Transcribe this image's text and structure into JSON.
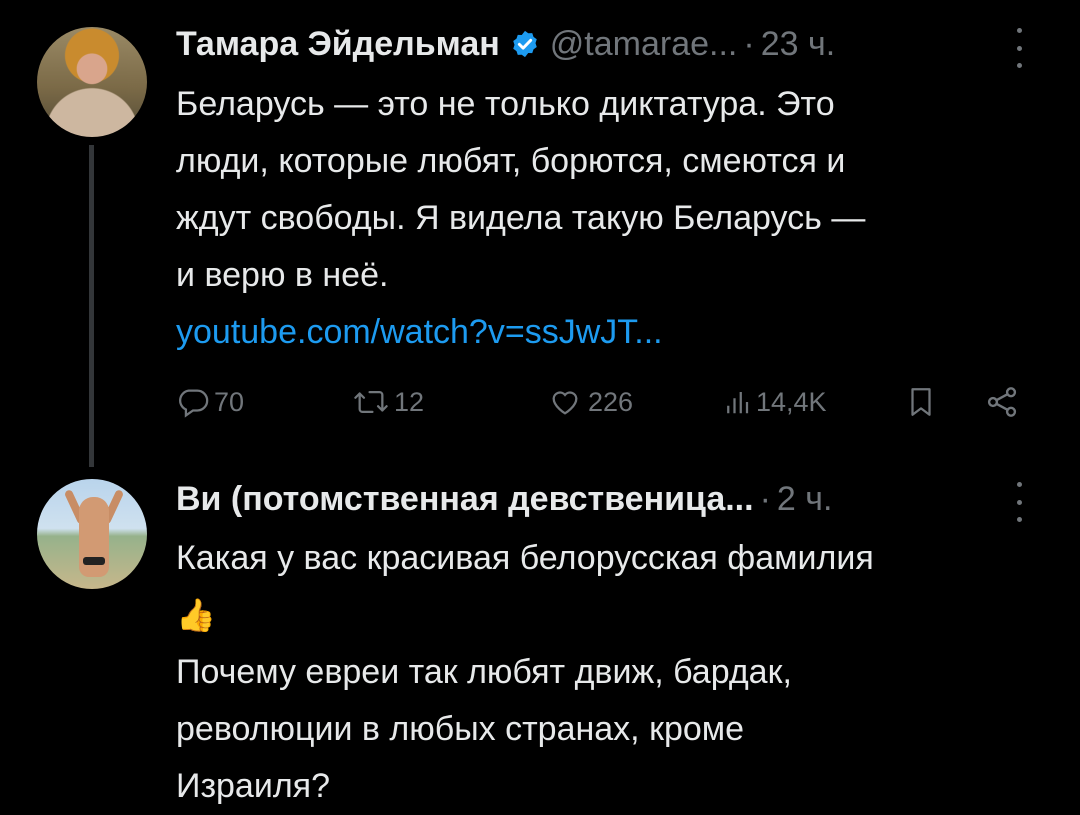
{
  "tweets": [
    {
      "author": "Тамара Эйдельман",
      "handle": "@tamarae...",
      "sep": "·",
      "time": "23 ч.",
      "lines": [
        "Беларусь — это не только диктатура.  Это",
        "люди, которые любят, борются, смеются и",
        "ждут свободы. Я видела такую Беларусь —",
        "и верю в неё."
      ],
      "link": "youtube.com/watch?v=ssJwJT...",
      "replies": "70",
      "reposts": "12",
      "likes": "226",
      "views": "14,4K"
    },
    {
      "author": "Ви (потомственная девственица...",
      "sep": "·",
      "time": "2 ч.",
      "line1": "Какая у вас красивая белорусская фамилия",
      "emoji": "👍",
      "lines2": [
        "Почему евреи так любят движ, бардак,",
        "революции в любых странах, кроме",
        "Израиля?"
      ]
    }
  ],
  "colors": {
    "background": "#000000",
    "text": "#e7e9ea",
    "muted": "#71767b",
    "link": "#1d9bf0",
    "verified": "#1d9bf0"
  },
  "icons": [
    "verified-badge-icon",
    "more-icon",
    "reply-icon",
    "repost-icon",
    "like-icon",
    "views-icon",
    "bookmark-icon",
    "share-icon"
  ]
}
